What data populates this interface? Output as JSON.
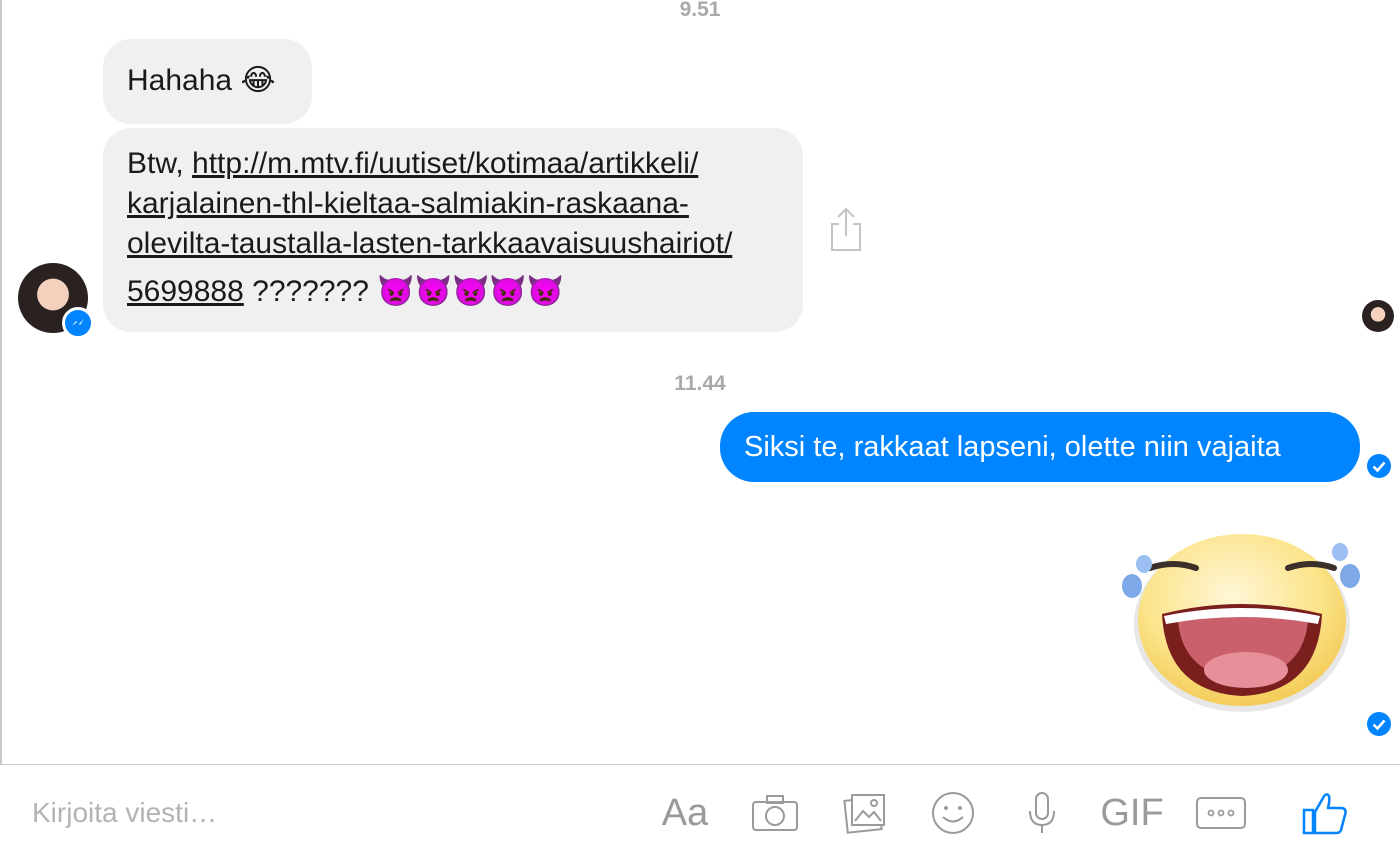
{
  "conversation": {
    "timestamps": [
      "9.51",
      "11.44"
    ],
    "incoming": {
      "msg1": {
        "text": "Hahaha",
        "emoji": "😂"
      },
      "msg2": {
        "prefix": "Btw, ",
        "link_lines": [
          "http://m.mtv.fi/uutiset/kotimaa/artikkeli/",
          "karjalainen-thl-kieltaa-salmiakin-raskaana-",
          "olevilta-taustalla-lasten-tarkkaavaisuushairiot/",
          "5699888"
        ],
        "suffix": " ???????",
        "emoji": "👿👿👿👿👿"
      }
    },
    "outgoing": {
      "msg1": {
        "text": "Siksi te, rakkaat lapseni, olette niin vajaita"
      },
      "sticker": "laughing-tears-sticker"
    }
  },
  "composer": {
    "placeholder": "Kirjoita viesti…",
    "font_button": "Aa",
    "gif_button": "GIF",
    "icons": [
      "font-icon",
      "camera-icon",
      "gallery-icon",
      "emoji-icon",
      "microphone-icon",
      "gif-icon",
      "more-icon",
      "like-icon"
    ]
  },
  "colors": {
    "accent": "#0084ff",
    "incoming_bubble": "#f1f0f0",
    "timestamp": "#a9a9a9",
    "toolbar_icon": "#9a9a9a"
  }
}
